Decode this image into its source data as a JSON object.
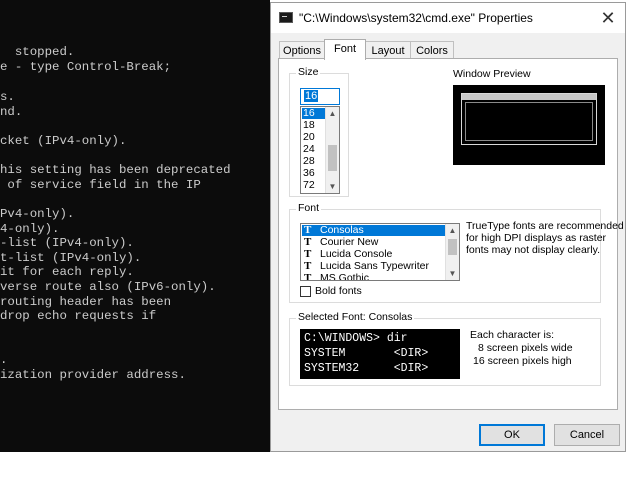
{
  "console": {
    "lines": [
      "  stopped.",
      "e - type Control-Break;",
      "",
      "s.",
      "nd.",
      "",
      "cket (IPv4-only).",
      "",
      "his setting has been deprecated",
      " of service field in the IP",
      "",
      "Pv4-only).",
      "4-only).",
      "-list (IPv4-only).",
      "t-list (IPv4-only).",
      "it for each reply.",
      "verse route also (IPv6-only).",
      "routing header has been",
      "drop echo requests if",
      "",
      "",
      "",
      ".",
      "ization provider address."
    ]
  },
  "dialog": {
    "title": "\"C:\\Windows\\system32\\cmd.exe\" Properties",
    "close_glyph": "✕",
    "tabs": [
      "Options",
      "Font",
      "Layout",
      "Colors"
    ],
    "active_tab": "Font",
    "size": {
      "label": "Size",
      "input_value": "16",
      "items": [
        "16",
        "18",
        "20",
        "24",
        "28",
        "36",
        "72"
      ],
      "selected": "16"
    },
    "window_preview_label": "Window Preview",
    "font": {
      "label": "Font",
      "items": [
        "Consolas",
        "Courier New",
        "Lucida Console",
        "Lucida Sans Typewriter",
        "MS Gothic"
      ],
      "selected": "Consolas",
      "icon_glyph": "T",
      "truetype_note": "TrueType fonts are recommended for high DPI displays as raster fonts may not display clearly.",
      "bold_label": "Bold fonts"
    },
    "selected_font": {
      "label": "Selected Font: Consolas",
      "sample_lines": [
        "C:\\WINDOWS> dir",
        "SYSTEM       <DIR>",
        "SYSTEM32     <DIR>"
      ],
      "char_header": "Each character is:",
      "char_width": "8 screen pixels wide",
      "char_height": "16 screen pixels high"
    },
    "buttons": {
      "ok": "OK",
      "cancel": "Cancel"
    }
  }
}
